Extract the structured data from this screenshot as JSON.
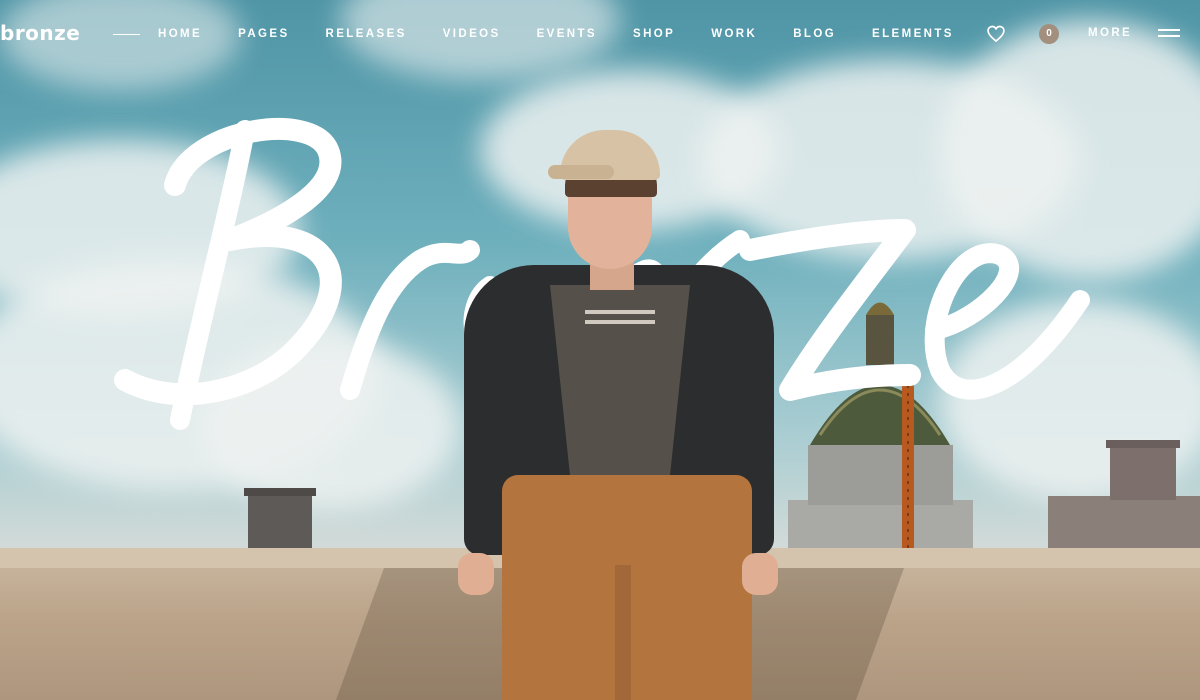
{
  "header": {
    "logo": "bronze",
    "menu": [
      {
        "label": "HOME"
      },
      {
        "label": "PAGES"
      },
      {
        "label": "RELEASES"
      },
      {
        "label": "VIDEOS"
      },
      {
        "label": "EVENTS"
      },
      {
        "label": "SHOP"
      },
      {
        "label": "WORK"
      },
      {
        "label": "BLOG"
      },
      {
        "label": "ELEMENTS"
      }
    ],
    "cart_count": "0",
    "more_label": "MORE"
  },
  "hero": {
    "script_title": "Bronze"
  },
  "icons": {
    "wishlist": "heart-icon",
    "menu": "hamburger-icon"
  },
  "colors": {
    "text": "#ffffff",
    "badge": "#a38f7d",
    "sky": "#6fb0bd",
    "wall": "#bba48a"
  }
}
